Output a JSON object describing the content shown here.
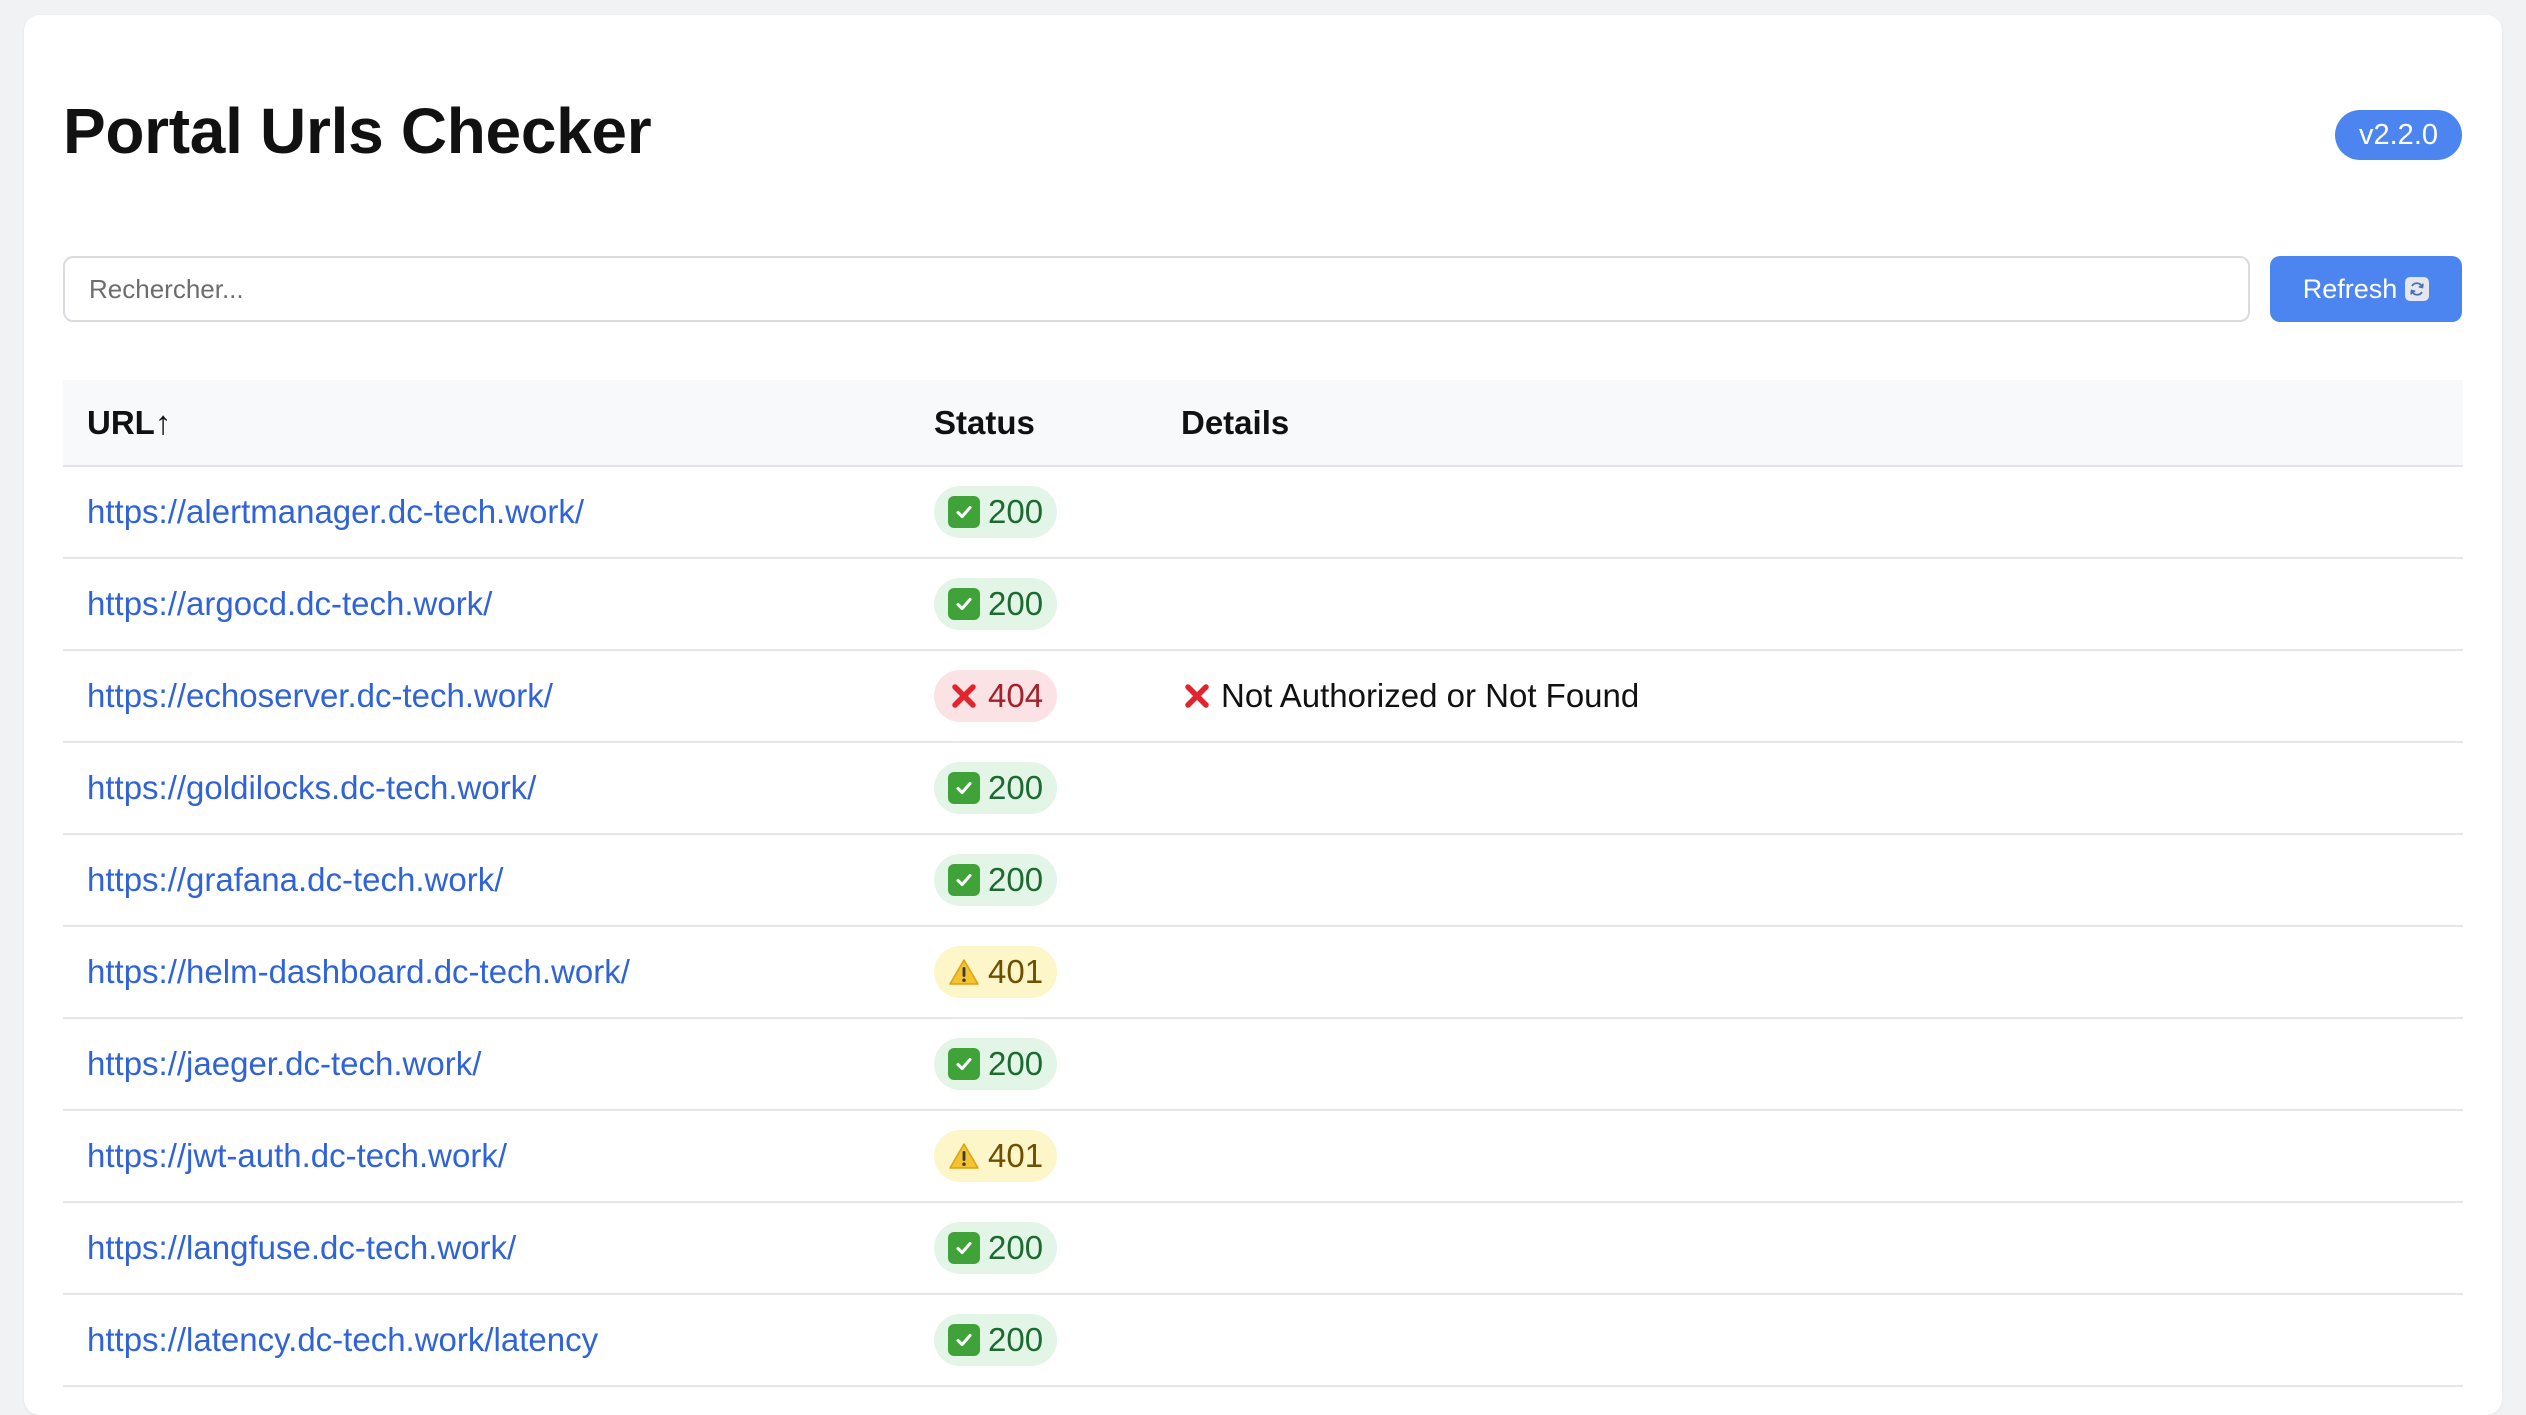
{
  "header": {
    "title": "Portal Urls Checker",
    "version": "v2.2.0"
  },
  "search": {
    "placeholder": "Rechercher...",
    "value": ""
  },
  "toolbar": {
    "refresh_label": "Refresh"
  },
  "table": {
    "columns": {
      "url": "URL↑",
      "status": "Status",
      "details": "Details"
    },
    "rows": [
      {
        "url": "https://alertmanager.dc-tech.work/",
        "status": "200",
        "kind": "ok",
        "details": ""
      },
      {
        "url": "https://argocd.dc-tech.work/",
        "status": "200",
        "kind": "ok",
        "details": ""
      },
      {
        "url": "https://echoserver.dc-tech.work/",
        "status": "404",
        "kind": "err",
        "details": "Not Authorized or Not Found"
      },
      {
        "url": "https://goldilocks.dc-tech.work/",
        "status": "200",
        "kind": "ok",
        "details": ""
      },
      {
        "url": "https://grafana.dc-tech.work/",
        "status": "200",
        "kind": "ok",
        "details": ""
      },
      {
        "url": "https://helm-dashboard.dc-tech.work/",
        "status": "401",
        "kind": "warn",
        "details": ""
      },
      {
        "url": "https://jaeger.dc-tech.work/",
        "status": "200",
        "kind": "ok",
        "details": ""
      },
      {
        "url": "https://jwt-auth.dc-tech.work/",
        "status": "401",
        "kind": "warn",
        "details": ""
      },
      {
        "url": "https://langfuse.dc-tech.work/",
        "status": "200",
        "kind": "ok",
        "details": ""
      },
      {
        "url": "https://latency.dc-tech.work/latency",
        "status": "200",
        "kind": "ok",
        "details": ""
      }
    ]
  },
  "colors": {
    "accent": "#4c85ef",
    "link": "#2f63d6",
    "ok_bg": "#e2f5e6",
    "err_bg": "#fbe2e4",
    "warn_bg": "#fdf6c9"
  }
}
